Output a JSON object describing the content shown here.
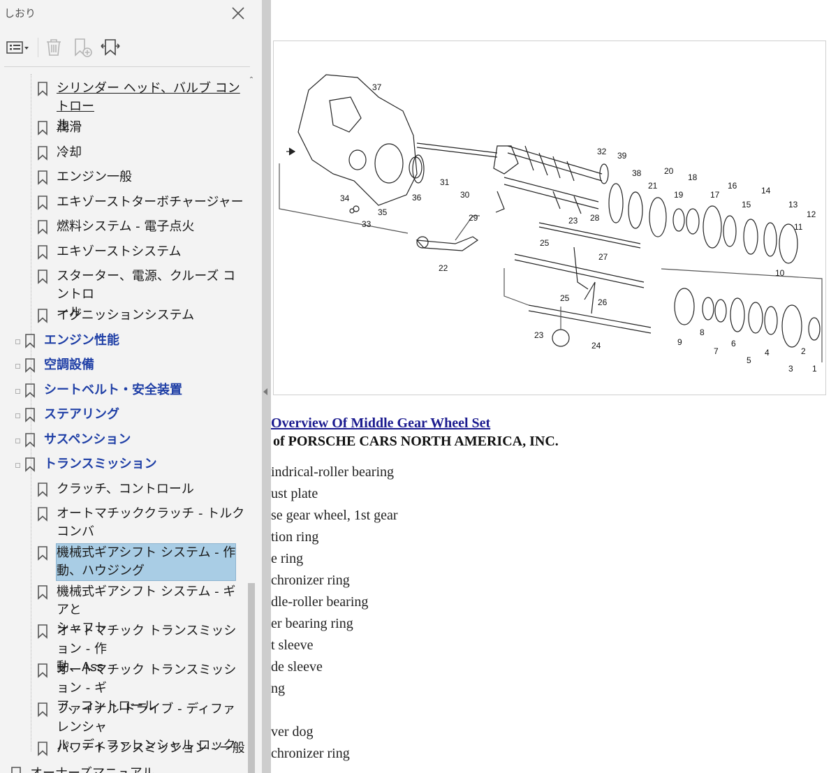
{
  "panel": {
    "title": "しおり",
    "toolbar": {
      "options_icon": "options-menu-icon",
      "delete_icon": "trash-icon",
      "new_bookmark_icon": "add-bookmark-icon",
      "find_bookmark_icon": "find-current-bookmark-icon"
    },
    "scroll_position": 0.83,
    "bookmarks": [
      {
        "label_lines": [
          "シリンダー ヘッド、バルブ コントロー",
          "ル"
        ],
        "level": 2,
        "underline": true
      },
      {
        "label_lines": [
          "潤滑"
        ],
        "level": 2
      },
      {
        "label_lines": [
          "冷却"
        ],
        "level": 2
      },
      {
        "label_lines": [
          "エンジン一般"
        ],
        "level": 2
      },
      {
        "label_lines": [
          "エキゾーストターボチャージャー"
        ],
        "level": 2
      },
      {
        "label_lines": [
          "燃料システム - 電子点火"
        ],
        "level": 2
      },
      {
        "label_lines": [
          "エキゾーストシステム"
        ],
        "level": 2
      },
      {
        "label_lines": [
          "スターター、電源、クルーズ コントロ",
          "ール"
        ],
        "level": 2
      },
      {
        "label_lines": [
          "イグニッションシステム"
        ],
        "level": 2
      },
      {
        "label_lines": [
          "エンジン性能"
        ],
        "level": 1
      },
      {
        "label_lines": [
          "空調設備"
        ],
        "level": 1
      },
      {
        "label_lines": [
          "シートベルト・安全装置"
        ],
        "level": 1
      },
      {
        "label_lines": [
          "ステアリング"
        ],
        "level": 1
      },
      {
        "label_lines": [
          "サスペンション"
        ],
        "level": 1
      },
      {
        "label_lines": [
          "トランスミッション"
        ],
        "level": 1
      },
      {
        "label_lines": [
          "クラッチ、コントロール"
        ],
        "level": 2
      },
      {
        "label_lines": [
          "オートマチッククラッチ - トルクコンバ",
          "ーター"
        ],
        "level": 2
      },
      {
        "label_lines": [
          "機械式ギアシフト システム - 作",
          "動、ハウジング"
        ],
        "level": 2,
        "selected": true
      },
      {
        "label_lines": [
          "機械式ギアシフト システム - ギアと",
          "シャフト"
        ],
        "level": 2
      },
      {
        "label_lines": [
          "オートマチック トランスミッション - 作",
          "動、Ass"
        ],
        "level": 2
      },
      {
        "label_lines": [
          "オートマチック トランスミッション - ギ",
          "ア、コントロール"
        ],
        "level": 2
      },
      {
        "label_lines": [
          "ファイナル ドライブ - ディファレンシャ",
          "ル、ディファレンシャル ロック"
        ],
        "level": 2
      },
      {
        "label_lines": [
          "パワートランスミッション - 一般"
        ],
        "level": 2
      },
      {
        "label_lines": [
          "オーナーズマニュアル"
        ],
        "level": 0
      }
    ]
  },
  "document": {
    "figure_labels": [
      "37",
      "32",
      "39",
      "38",
      "20",
      "18",
      "21",
      "19",
      "17",
      "16",
      "14",
      "13",
      "12",
      "11",
      "15",
      "10",
      "31",
      "30",
      "36",
      "34",
      "35",
      "33",
      "29",
      "23",
      "28",
      "25",
      "22",
      "27",
      "26",
      "24",
      "9",
      "8",
      "7",
      "6",
      "5",
      "4",
      "3",
      "2",
      "1",
      "23",
      "25"
    ],
    "title": "Overview Of Middle Gear Wheel Set",
    "subtitle": "of PORSCHE CARS NORTH AMERICA, INC.",
    "lines": [
      "indrical-roller bearing",
      "ust plate",
      "se gear wheel, 1st gear",
      "tion ring",
      "e ring",
      "chronizer ring",
      "dle-roller bearing",
      "er bearing ring",
      "t sleeve",
      "de sleeve",
      "ng",
      "",
      "ver dog",
      "chronizer ring",
      ""
    ]
  },
  "colors": {
    "panel_bg": "#f3f3f3",
    "top_level_text": "#1f3fa6",
    "selection": "#a9cde5",
    "splitter": "#cdcdcd",
    "doc_title": "#1b1b8f"
  }
}
